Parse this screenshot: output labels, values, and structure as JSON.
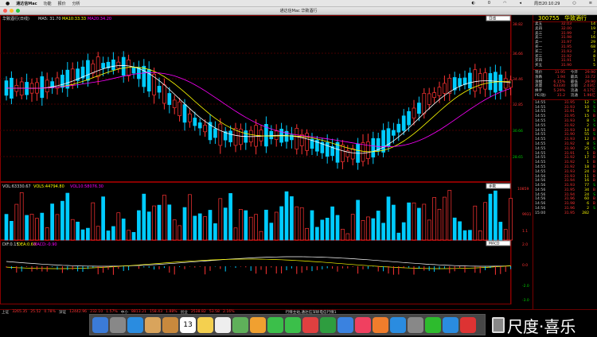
{
  "menubar": {
    "apple": "",
    "app": "通达信Mac",
    "items": [
      "功能",
      "报价",
      "分析"
    ],
    "right": [
      "0",
      "",
      "",
      "",
      "",
      "",
      "",
      "周日20:10:29",
      "",
      "",
      ""
    ]
  },
  "window": {
    "title": "通达信Mac 华致酒行"
  },
  "main": {
    "title": "华致酒行(日线)",
    "ma5": "MA5: 31.70",
    "ma10": "MA10:33.33",
    "ma20": "MA20:34.20",
    "mode": "日线",
    "vol": {
      "vol": "VOL:63330.67",
      "vol5": "VOL5:44794.80",
      "vol10": "VOL10:58076.30",
      "mode": "手数",
      "ticks": [
        "10859",
        "9931",
        "1.1",
        "0"
      ]
    },
    "macd": {
      "dif": "DIF:0.15",
      "dea": "DEA:0.60",
      "macd": "MACD:-0.90",
      "mode": "MACD",
      "ticks": [
        "2.0",
        "0.0",
        "-2.0",
        "-3.0"
      ]
    },
    "price_ticks": [
      "38.82",
      "36.66",
      "34.46",
      "32.85",
      "30.66",
      "28.65"
    ]
  },
  "right": {
    "code": "300755",
    "name": "华致酒行",
    "book": [
      {
        "l": "卖五",
        "p": "32.03",
        "v": "14"
      },
      {
        "l": "卖四",
        "p": "32.00",
        "v": "19"
      },
      {
        "l": "卖三",
        "p": "31.99",
        "v": "7"
      },
      {
        "l": "卖二",
        "p": "31.98",
        "v": "16"
      },
      {
        "l": "卖一",
        "p": "31.97",
        "v": "29"
      },
      {
        "l": "买一",
        "p": "31.95",
        "v": "68"
      },
      {
        "l": "买二",
        "p": "31.93",
        "v": "3"
      },
      {
        "l": "买三",
        "p": "31.92",
        "v": "8"
      },
      {
        "l": "买四",
        "p": "31.91",
        "v": "1"
      },
      {
        "l": "买五",
        "p": "31.90",
        "v": "5"
      }
    ],
    "stats": [
      {
        "l": "现价",
        "v": "31.95",
        "l2": "今开",
        "v2": "29.90"
      },
      {
        "l": "涨跌",
        "v": "1.94",
        "l2": "最高",
        "v2": "33.72"
      },
      {
        "l": "涨幅",
        "v": "6.15%",
        "l2": "最低",
        "v2": "29.90"
      },
      {
        "l": "总量",
        "v": "63330",
        "l2": "总额",
        "v2": "2.03亿"
      },
      {
        "l": "换手",
        "v": "5.29%",
        "l2": "流通",
        "v2": "4.17亿"
      },
      {
        "l": "PE(动)",
        "v": "31.2",
        "l2": "流通",
        "v2": "1.96亿"
      }
    ],
    "ticks": [
      {
        "t": "14:55",
        "p": "31.95",
        "v": "12",
        "s": "S"
      },
      {
        "t": "14:55",
        "p": "31.93",
        "v": "10",
        "s": "S"
      },
      {
        "t": "14:55",
        "p": "31.91",
        "v": "9",
        "s": "S"
      },
      {
        "t": "14:55",
        "p": "31.95",
        "v": "15",
        "s": "B"
      },
      {
        "t": "14:55",
        "p": "31.93",
        "v": "8",
        "s": "S"
      },
      {
        "t": "14:55",
        "p": "31.92",
        "v": "2",
        "s": "S"
      },
      {
        "t": "14:55",
        "p": "31.93",
        "v": "14",
        "s": "B"
      },
      {
        "t": "14:55",
        "p": "31.90",
        "v": "55",
        "s": "S"
      },
      {
        "t": "14:55",
        "p": "31.93",
        "v": "12",
        "s": "B"
      },
      {
        "t": "14:55",
        "p": "31.92",
        "v": "8",
        "s": "S"
      },
      {
        "t": "14:55",
        "p": "31.90",
        "v": "25",
        "s": "S"
      },
      {
        "t": "14:55",
        "p": "31.91",
        "v": "1",
        "s": "B"
      },
      {
        "t": "14:55",
        "p": "31.92",
        "v": "17",
        "s": "B"
      },
      {
        "t": "14:55",
        "p": "31.92",
        "v": "1",
        "s": "B"
      },
      {
        "t": "14:55",
        "p": "31.92",
        "v": "18",
        "s": "B"
      },
      {
        "t": "14:55",
        "p": "31.93",
        "v": "24",
        "s": "B"
      },
      {
        "t": "14:56",
        "p": "31.93",
        "v": "11",
        "s": "B"
      },
      {
        "t": "14:56",
        "p": "31.94",
        "v": "16",
        "s": "B"
      },
      {
        "t": "14:56",
        "p": "31.93",
        "v": "77",
        "s": "S"
      },
      {
        "t": "14:56",
        "p": "31.95",
        "v": "34",
        "s": "B"
      },
      {
        "t": "14:56",
        "p": "31.94",
        "v": "24",
        "s": "S"
      },
      {
        "t": "14:56",
        "p": "31.96",
        "v": "60",
        "s": "B"
      },
      {
        "t": "14:56",
        "p": "31.98",
        "v": "6",
        "s": "B"
      },
      {
        "t": "14:56",
        "p": "31.96",
        "v": "2",
        "s": "S"
      },
      {
        "t": "15:00",
        "p": "31.95",
        "v": "282",
        "s": ""
      }
    ]
  },
  "status": {
    "items": [
      "上证",
      "3265.35",
      "25.52",
      "0.78%",
      "深证",
      "12442.96",
      "232.10",
      "1.57%",
      "中小",
      "8813.21",
      "158.43",
      "1.88%",
      "创业",
      "2538.82",
      "53.58",
      "2.16%",
      "行情主站,通达信深圳电信行情1"
    ]
  },
  "dock": {
    "icons": [
      "finder-icon",
      "launchpad-icon",
      "safari-icon",
      "mail-icon",
      "contacts-icon",
      "calendar-icon",
      "notes-icon",
      "reminders-icon",
      "maps-icon",
      "photos-icon",
      "messages-icon",
      "facetime-icon",
      "calendar-alt-icon",
      "numbers-icon",
      "keynote-icon",
      "music-icon",
      "books-icon",
      "appstore-icon",
      "settings-icon",
      "wechat-icon",
      "qq-icon",
      "tdx-icon",
      "trash-icon"
    ],
    "calendar_day": "13"
  },
  "watermark": {
    "text": "尺度·喜乐"
  }
}
